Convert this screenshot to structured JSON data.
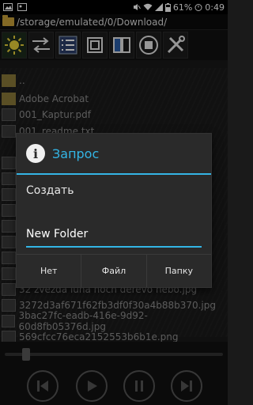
{
  "statusbar": {
    "battery_pct": "61%",
    "time": "0:49"
  },
  "path": "/storage/emulated/0/Download/",
  "toolbar": {
    "tools": [
      "sun-icon",
      "swap-arrows-icon",
      "checklist-icon",
      "window-icon",
      "book-icon",
      "stop-icon",
      "tools-icon"
    ]
  },
  "files": [
    {
      "name": "..",
      "folder": true
    },
    {
      "name": "Adobe Acrobat",
      "folder": true
    },
    {
      "name": "001_Kaptur.pdf",
      "folder": false
    },
    {
      "name": "001_readme.txt",
      "folder": false
    },
    {
      "name": "32 zvezda luna noch derevo nebo.jpg",
      "folder": false
    },
    {
      "name": "3272d3af671f62fb3df0f30a4b88b370.jpg",
      "folder": false
    },
    {
      "name": "3bac27fc-eadb-416e-9d92-60d8fb05376d.jpg",
      "folder": false
    },
    {
      "name": "569cfcc76eca2152553b6b1e.png",
      "folder": false
    }
  ],
  "dialog": {
    "title": "Запрос",
    "message": "Создать",
    "input_value": "New Folder",
    "buttons": {
      "no": "Нет",
      "file": "Файл",
      "folder": "Папку"
    }
  },
  "colors": {
    "accent": "#33b5e5",
    "folder": "#c9a23a"
  }
}
